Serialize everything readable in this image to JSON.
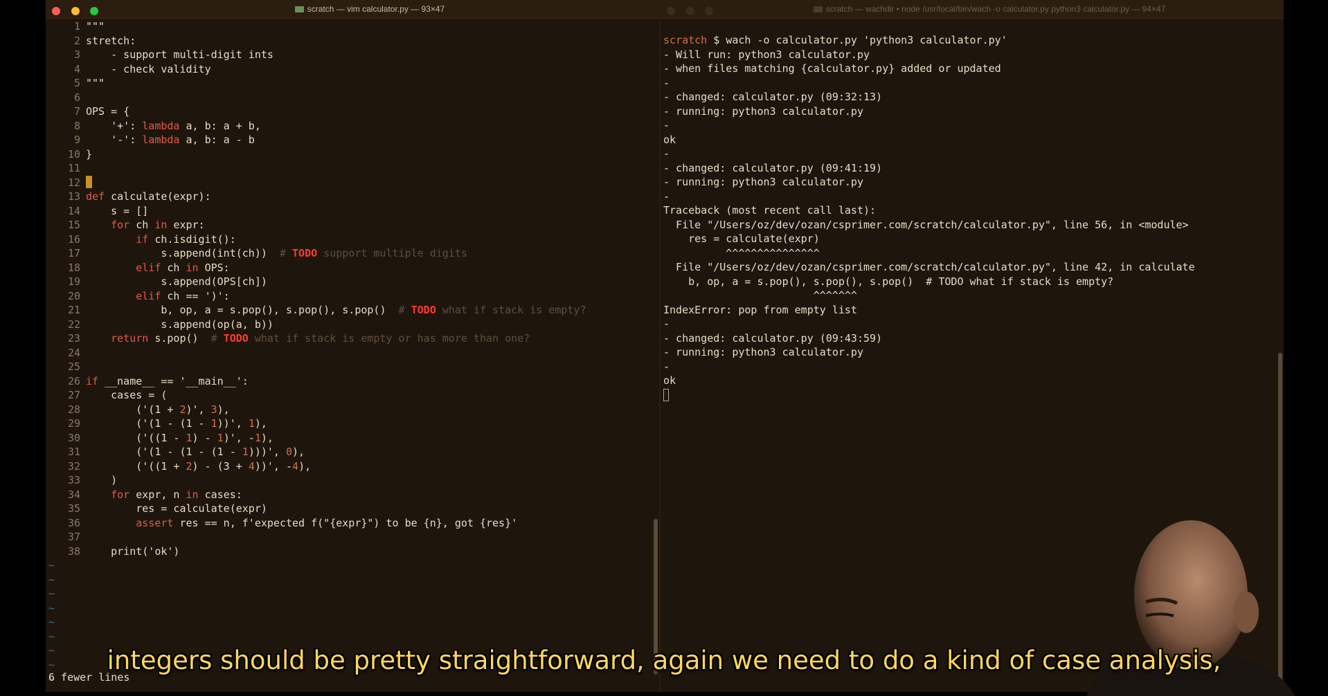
{
  "left_window": {
    "title": "scratch — vim calculator.py — 93×47",
    "status_line": "6 fewer lines",
    "empty_line_marker": "~"
  },
  "right_window": {
    "title": "scratch — wachdir • node /usr/local/bin/wach -o calculator.py python3 calculator.py — 94×47"
  },
  "code_lines": [
    {
      "num": "1",
      "text": "\"\"\""
    },
    {
      "num": "2",
      "text": "stretch:"
    },
    {
      "num": "3",
      "text": "    - support multi-digit ints"
    },
    {
      "num": "4",
      "text": "    - check validity"
    },
    {
      "num": "5",
      "text": "\"\"\""
    },
    {
      "num": "6",
      "text": ""
    },
    {
      "num": "7",
      "text": "OPS = {"
    },
    {
      "num": "8",
      "text": "    '+': lambda a, b: a + b,"
    },
    {
      "num": "9",
      "text": "    '-': lambda a, b: a - b"
    },
    {
      "num": "10",
      "text": "}"
    },
    {
      "num": "11",
      "text": ""
    },
    {
      "num": "12",
      "text": ""
    },
    {
      "num": "13",
      "text": "def calculate(expr):"
    },
    {
      "num": "14",
      "text": "    s = []"
    },
    {
      "num": "15",
      "text": "    for ch in expr:"
    },
    {
      "num": "16",
      "text": "        if ch.isdigit():"
    },
    {
      "num": "17",
      "text": "            s.append(int(ch))  # TODO support multiple digits"
    },
    {
      "num": "18",
      "text": "        elif ch in OPS:"
    },
    {
      "num": "19",
      "text": "            s.append(OPS[ch])"
    },
    {
      "num": "20",
      "text": "        elif ch == ')':"
    },
    {
      "num": "21",
      "text": "            b, op, a = s.pop(), s.pop(), s.pop()  # TODO what if stack is empty?"
    },
    {
      "num": "22",
      "text": "            s.append(op(a, b))"
    },
    {
      "num": "23",
      "text": "    return s.pop()  # TODO what if stack is empty or has more than one?"
    },
    {
      "num": "24",
      "text": ""
    },
    {
      "num": "25",
      "text": ""
    },
    {
      "num": "26",
      "text": "if __name__ == '__main__':"
    },
    {
      "num": "27",
      "text": "    cases = ("
    },
    {
      "num": "28",
      "text": "        ('(1 + 2)', 3),"
    },
    {
      "num": "29",
      "text": "        ('(1 - (1 - 1))', 1),"
    },
    {
      "num": "30",
      "text": "        ('((1 - 1) - 1)', -1),"
    },
    {
      "num": "31",
      "text": "        ('(1 - (1 - (1 - 1)))', 0),"
    },
    {
      "num": "32",
      "text": "        ('((1 + 2) - (3 + 4))', -4),"
    },
    {
      "num": "33",
      "text": "    )"
    },
    {
      "num": "34",
      "text": "    for expr, n in cases:"
    },
    {
      "num": "35",
      "text": "        res = calculate(expr)"
    },
    {
      "num": "36",
      "text": "        assert res == n, f'expected f(\"{expr}\") to be {n}, got {res}'"
    },
    {
      "num": "37",
      "text": ""
    },
    {
      "num": "38",
      "text": "    print('ok')"
    }
  ],
  "terminal": {
    "prompt_dir": "scratch",
    "prompt_cmd": " $ wach -o calculator.py 'python3 calculator.py'",
    "lines": [
      "- Will run: python3 calculator.py",
      "- when files matching {calculator.py} added or updated",
      "-",
      "- changed: calculator.py (09:32:13)",
      "- running: python3 calculator.py",
      "-",
      "ok",
      "-",
      "- changed: calculator.py (09:41:19)",
      "- running: python3 calculator.py",
      "-",
      "Traceback (most recent call last):",
      "  File \"/Users/oz/dev/ozan/csprimer.com/scratch/calculator.py\", line 56, in <module>",
      "    res = calculate(expr)",
      "          ^^^^^^^^^^^^^^^",
      "  File \"/Users/oz/dev/ozan/csprimer.com/scratch/calculator.py\", line 42, in calculate",
      "    b, op, a = s.pop(), s.pop(), s.pop()  # TODO what if stack is empty?",
      "                        ^^^^^^^",
      "IndexError: pop from empty list",
      "-",
      "- changed: calculator.py (09:43:59)",
      "- running: python3 calculator.py",
      "-",
      "ok"
    ]
  },
  "caption": "integers should be pretty straightforward, again we need to do a kind of case analysis,",
  "colors": {
    "background": "#1e160d",
    "keyword": "#e05a4a",
    "number": "#d0704d",
    "comment": "#5f4e3d",
    "todo": "#ff3b30",
    "caption": "#ffd75a"
  }
}
